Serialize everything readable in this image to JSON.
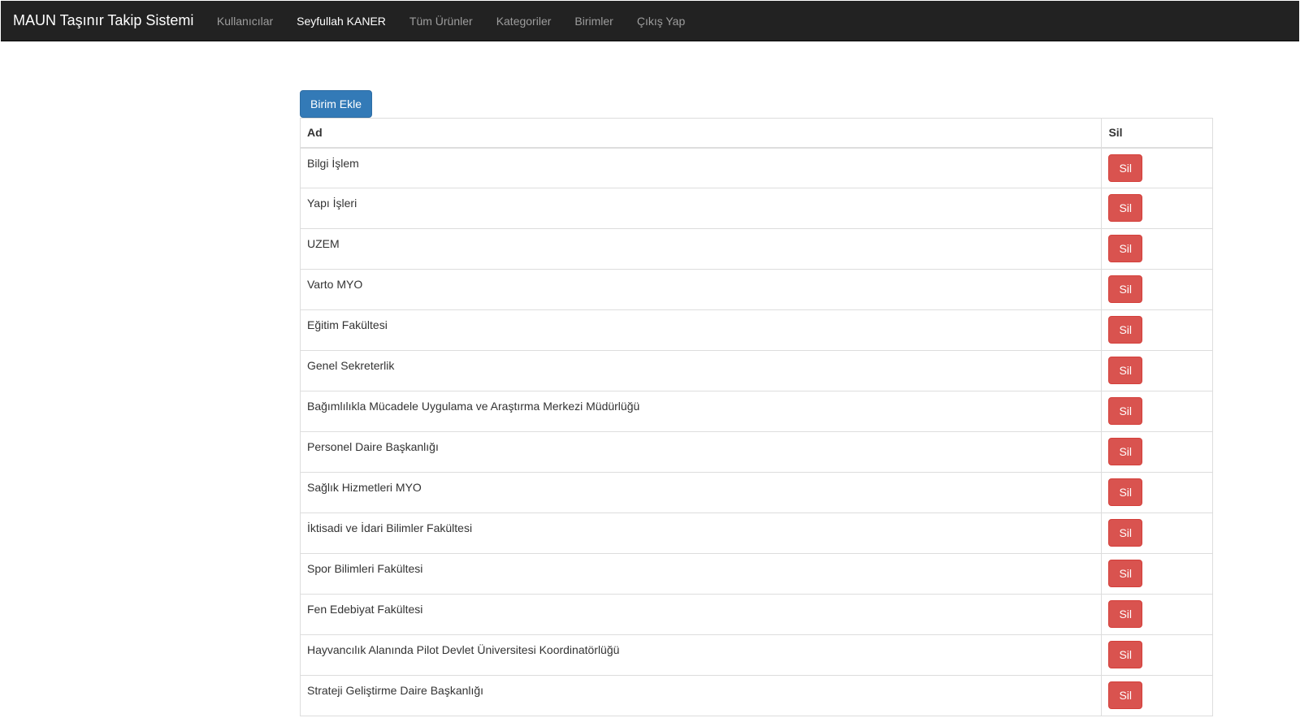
{
  "navbar": {
    "brand": "MAUN Taşınır Takip Sistemi",
    "items": [
      {
        "label": "Kullanıcılar"
      },
      {
        "label": "Seyfullah KANER"
      },
      {
        "label": "Tüm Ürünler"
      },
      {
        "label": "Kategoriler"
      },
      {
        "label": "Birimler"
      },
      {
        "label": "Çıkış Yap"
      }
    ]
  },
  "toolbar": {
    "add_label": "Birim Ekle"
  },
  "table": {
    "headers": [
      "Ad",
      "Sil"
    ],
    "delete_label": "Sil",
    "rows": [
      "Bilgi İşlem",
      "Yapı İşleri",
      "UZEM",
      "Varto MYO",
      "Eğitim Fakültesi",
      "Genel Sekreterlik",
      "Bağımlılıkla Mücadele Uygulama ve Araştırma Merkezi Müdürlüğü",
      "Personel Daire Başkanlığı",
      "Sağlık Hizmetleri MYO",
      "İktisadi ve İdari Bilimler Fakültesi",
      "Spor Bilimleri Fakültesi",
      "Fen Edebiyat Fakültesi",
      "Hayvancılık Alanında Pilot Devlet Üniversitesi Koordinatörlüğü",
      "Strateji Geliştirme Daire Başkanlığı"
    ]
  }
}
